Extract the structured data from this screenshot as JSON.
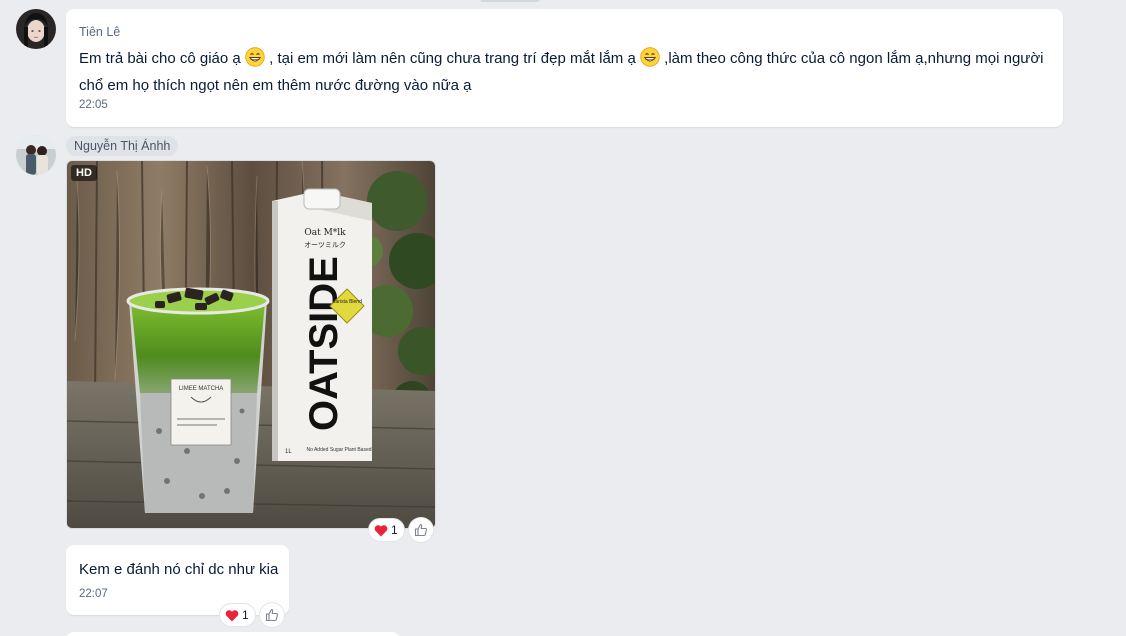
{
  "messages": [
    {
      "sender": "Tiên Lê",
      "text_part1": "Em trả bài cho cô giáo ạ",
      "text_part2": ", tại em mới làm nên cũng chưa trang trí đẹp mắt lắm ạ",
      "text_part3": ",làm theo công thức của cô ngon lắm ạ,nhưng mọi người",
      "text_line2": "chổ em họ thích ngọt nên em thêm nước đường vào nữa ạ",
      "time": "22:05",
      "emoji": "grinning-face-emoji"
    },
    {
      "sender": "Nguyễn Thị Ánhh",
      "photo_badge": "HD",
      "photo_reaction_count": "1",
      "photo_cup_label": "LIMEE MATCHA",
      "photo_carton_brand": "OATSIDE",
      "photo_carton_title": "Oat M*lk",
      "photo_carton_jp": "オーツミルク",
      "photo_carton_badge": "Barista Blend",
      "photo_carton_footer": "No Added Sugar Plant Based",
      "photo_carton_volume": "1L"
    },
    {
      "text": "Kem e đánh nó chỉ dc như kia",
      "time": "22:07",
      "reaction_count": "1"
    }
  ],
  "colors": {
    "background": "#ebecf0",
    "bubble": "#ffffff",
    "heart": "#e8243a",
    "text": "#081c36",
    "muted": "#5a6981"
  },
  "icons": [
    "heart-icon",
    "thumbs-up-icon",
    "grinning-face-emoji"
  ]
}
